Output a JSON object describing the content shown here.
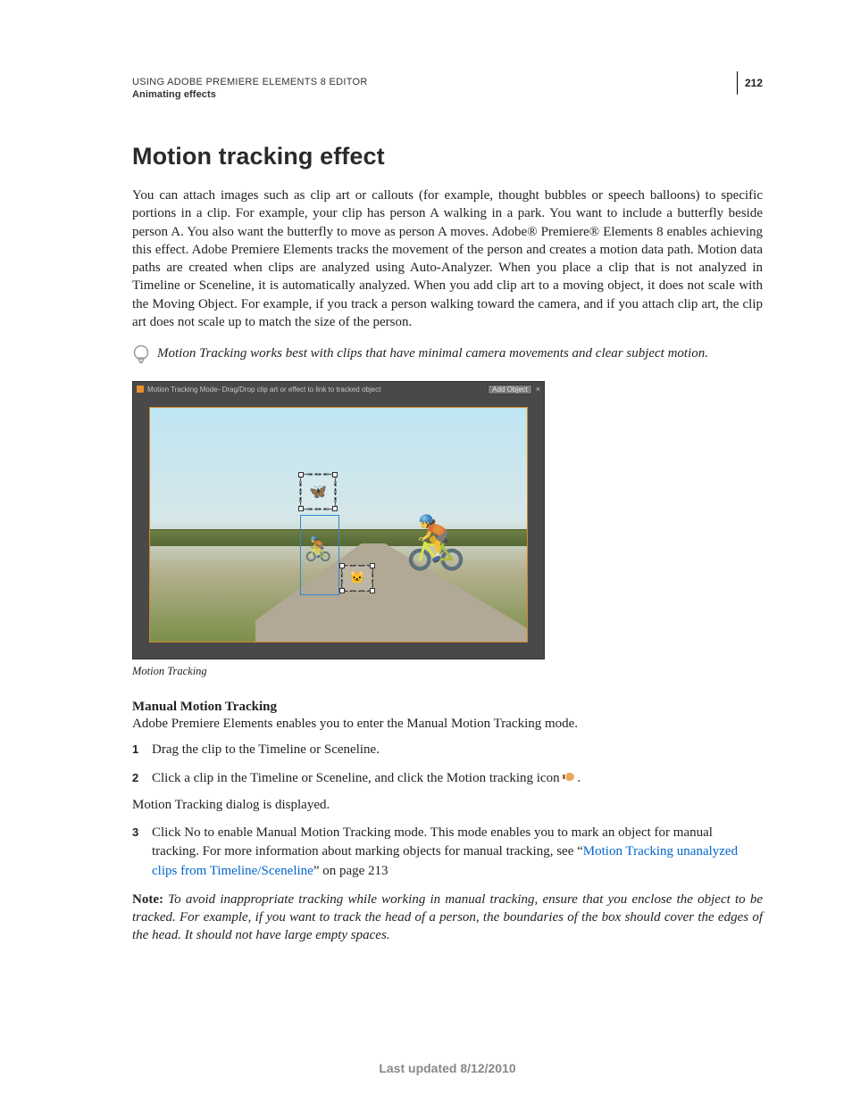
{
  "header": {
    "title": "USING ADOBE PREMIERE ELEMENTS 8 EDITOR",
    "subtitle": "Animating effects",
    "page_number": "212"
  },
  "heading": "Motion tracking effect",
  "body_paragraph": "You can attach images such as clip art or callouts (for example, thought bubbles or speech balloons) to specific portions in a clip. For example, your clip has person A walking in a park. You want to include a butterfly beside person A. You also want the butterfly to move as person A moves. Adobe® Premiere® Elements 8 enables achieving this effect. Adobe Premiere Elements tracks the movement of the person and creates a motion data path. Motion data paths are created when clips are analyzed using Auto-Analyzer. When you place a clip that is not analyzed in Timeline or Sceneline, it is automatically analyzed. When you add clip art to a moving object, it does not scale with the Moving Object. For example, if you track a person walking toward the camera, and if you attach clip art, the clip art does not scale up to match the size of the person.",
  "tip_text": "Motion Tracking works best with clips that have minimal camera movements and clear subject motion.",
  "figure": {
    "titlebar_label": "Motion Tracking Mode",
    "titlebar_hint": " - Drag/Drop clip art or effect to link to tracked object",
    "add_button": "Add Object",
    "caption": "Motion Tracking"
  },
  "subheading": "Manual Motion Tracking",
  "intro_line": "Adobe Premiere Elements enables you to enter the Manual Motion Tracking mode.",
  "steps": {
    "s1": "Drag the clip to the Timeline or Sceneline.",
    "s2_a": "Click a clip in the Timeline or Sceneline, and click the Motion tracking icon ",
    "s2_b": ".",
    "between": "Motion Tracking dialog is displayed.",
    "s3_a": "Click No to enable Manual Motion Tracking mode. This mode enables you to mark an object for manual tracking. For more information about marking objects for manual tracking, see “",
    "s3_link": "Motion Tracking unanalyzed clips from Timeline/Sceneline",
    "s3_b": "” on page 213"
  },
  "note": {
    "label": "Note:",
    "text": " To avoid inappropriate tracking while working in manual tracking, ensure that you enclose the object to be tracked. For example, if you want to track the head of a person, the boundaries of the box should cover the edges of the head. It should not have large empty spaces."
  },
  "footer": "Last updated 8/12/2010"
}
